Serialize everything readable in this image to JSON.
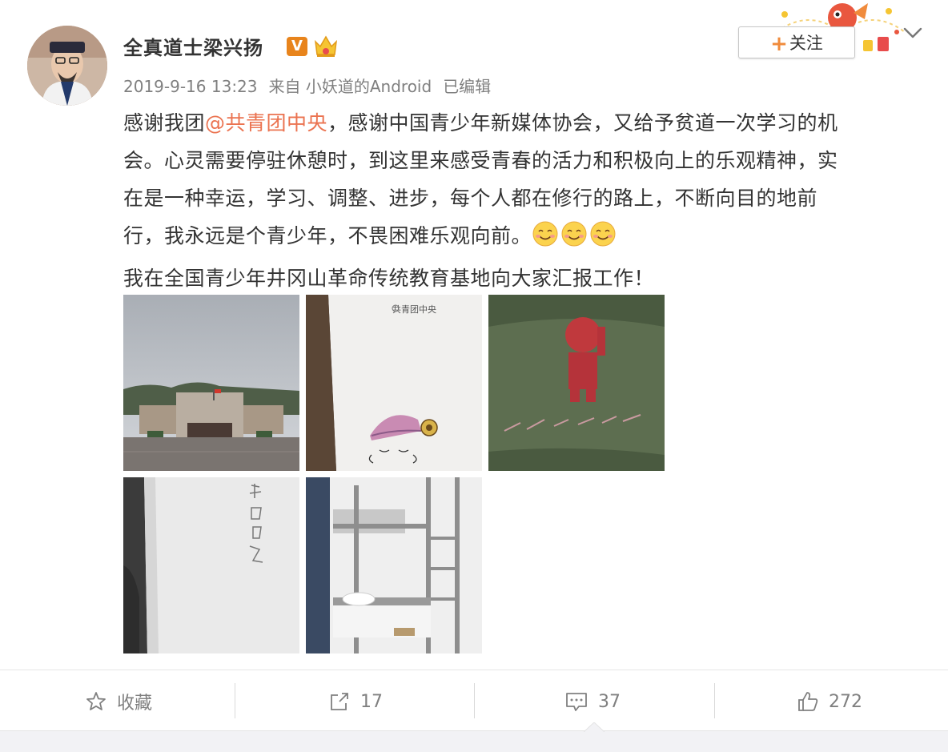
{
  "user": {
    "name": "全真道士梁兴扬",
    "verified_badge": "V",
    "timestamp": "2019-9-16 13:23",
    "source": "来自 小妖道的Android",
    "edited": "已编辑"
  },
  "follow": {
    "plus": "+",
    "label": "关注"
  },
  "post": {
    "line1_prefix": "感谢我团",
    "mention": "@共青团中央",
    "line1_suffix": "，感谢中国青少年新媒体协会，又给予贫道一次学习的机",
    "line2": "会。心灵需要停驻休憩时，到这里来感受青春的活力和积极向上的乐观精神，实",
    "line3": "在是一种幸运，学习、调整、进步，每个人都在修行的路上，不断向目的地前",
    "line4": "行，我永远是个青少年，不畏困难乐观向前。",
    "line5": "我在全国青少年井冈山革命传统教育基地向大家汇报工作！"
  },
  "images": [
    {
      "icon": "building-photo"
    },
    {
      "icon": "notebook-photo",
      "printed_text": "共青团中央"
    },
    {
      "icon": "green-bag-photo"
    },
    {
      "icon": "notebook-cover-photo"
    },
    {
      "icon": "bunk-bed-photo"
    }
  ],
  "actions": {
    "favorite": "收藏",
    "repost": "17",
    "comment": "37",
    "like": "272"
  },
  "colors": {
    "link": "#eb7350",
    "muted": "#808080",
    "badge": "#e8841c"
  }
}
